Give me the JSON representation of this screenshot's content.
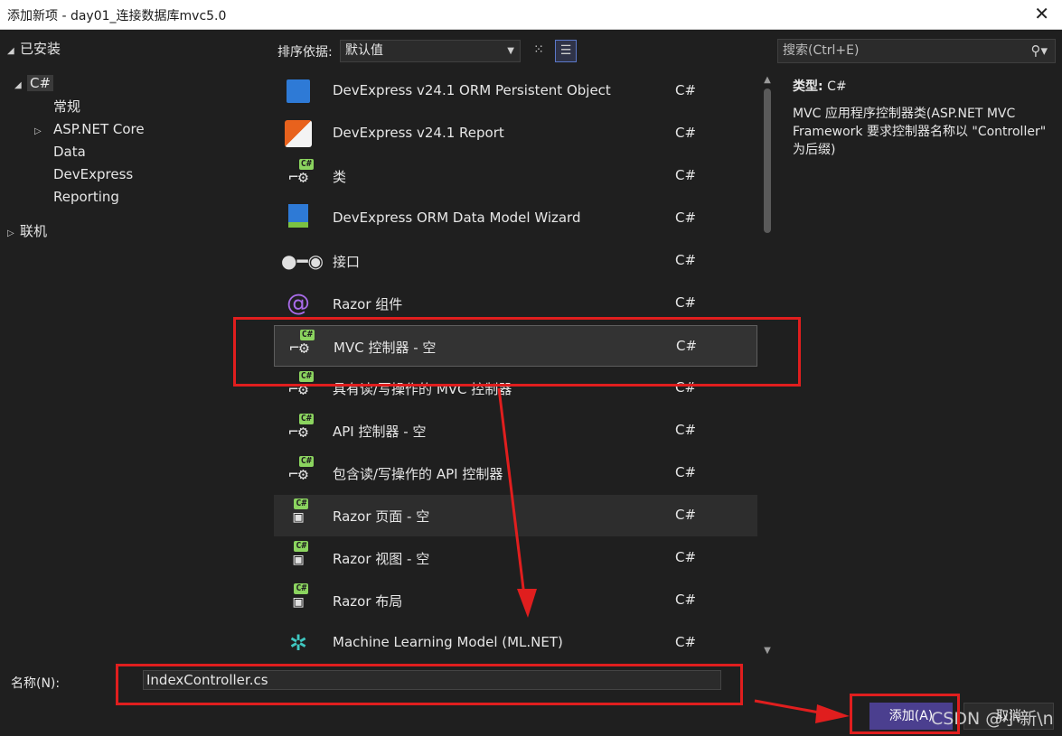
{
  "window": {
    "title": "添加新项 - day01_连接数据库mvc5.0",
    "close_label": "✕"
  },
  "tree": {
    "installed": "已安装",
    "csharp": "C#",
    "items": [
      "常规",
      "ASP.NET Core",
      "Data",
      "DevExpress",
      "Reporting"
    ],
    "online": "联机"
  },
  "toolbar": {
    "sort_label": "排序依据:",
    "sort_value": "默认值",
    "grid_view_icon": "grid-icon",
    "list_view_icon": "list-icon"
  },
  "search": {
    "placeholder": "搜索(Ctrl+E)",
    "icon": "search-icon"
  },
  "templates": [
    {
      "name": "DevExpress v24.1 ORM Persistent Object",
      "lang": "C#",
      "icon": "devexpress-orm-icon"
    },
    {
      "name": "DevExpress v24.1 Report",
      "lang": "C#",
      "icon": "devexpress-report-icon"
    },
    {
      "name": "类",
      "lang": "C#",
      "icon": "class-icon"
    },
    {
      "name": "DevExpress ORM Data Model Wizard",
      "lang": "C#",
      "icon": "data-model-icon"
    },
    {
      "name": "接口",
      "lang": "C#",
      "icon": "interface-icon"
    },
    {
      "name": "Razor 组件",
      "lang": "C#",
      "icon": "razor-component-icon"
    },
    {
      "name": "MVC 控制器 - 空",
      "lang": "C#",
      "icon": "controller-icon"
    },
    {
      "name": "具有读/写操作的 MVC 控制器",
      "lang": "C#",
      "icon": "controller-icon"
    },
    {
      "name": "API 控制器 - 空",
      "lang": "C#",
      "icon": "controller-icon"
    },
    {
      "name": "包含读/写操作的 API 控制器",
      "lang": "C#",
      "icon": "controller-icon"
    },
    {
      "name": "Razor 页面 - 空",
      "lang": "C#",
      "icon": "razor-page-icon"
    },
    {
      "name": "Razor 视图 - 空",
      "lang": "C#",
      "icon": "razor-view-icon"
    },
    {
      "name": "Razor 布局",
      "lang": "C#",
      "icon": "razor-layout-icon"
    },
    {
      "name": "Machine Learning Model (ML.NET)",
      "lang": "C#",
      "icon": "ml-model-icon"
    }
  ],
  "detail": {
    "type_label": "类型:",
    "type_value": "C#",
    "description": "MVC 应用程序控制器类(ASP.NET MVC Framework 要求控制器名称以 \"Controller\" 为后缀)"
  },
  "form": {
    "name_label": "名称(N):",
    "name_value": "IndexController.cs",
    "add_label": "添加(A)",
    "cancel_label": "取消"
  },
  "watermark": "CSDN @小新\\n",
  "colors": {
    "accent": "#4b3f8f",
    "annotation": "#e01e1e",
    "background": "#1f1f1f"
  }
}
